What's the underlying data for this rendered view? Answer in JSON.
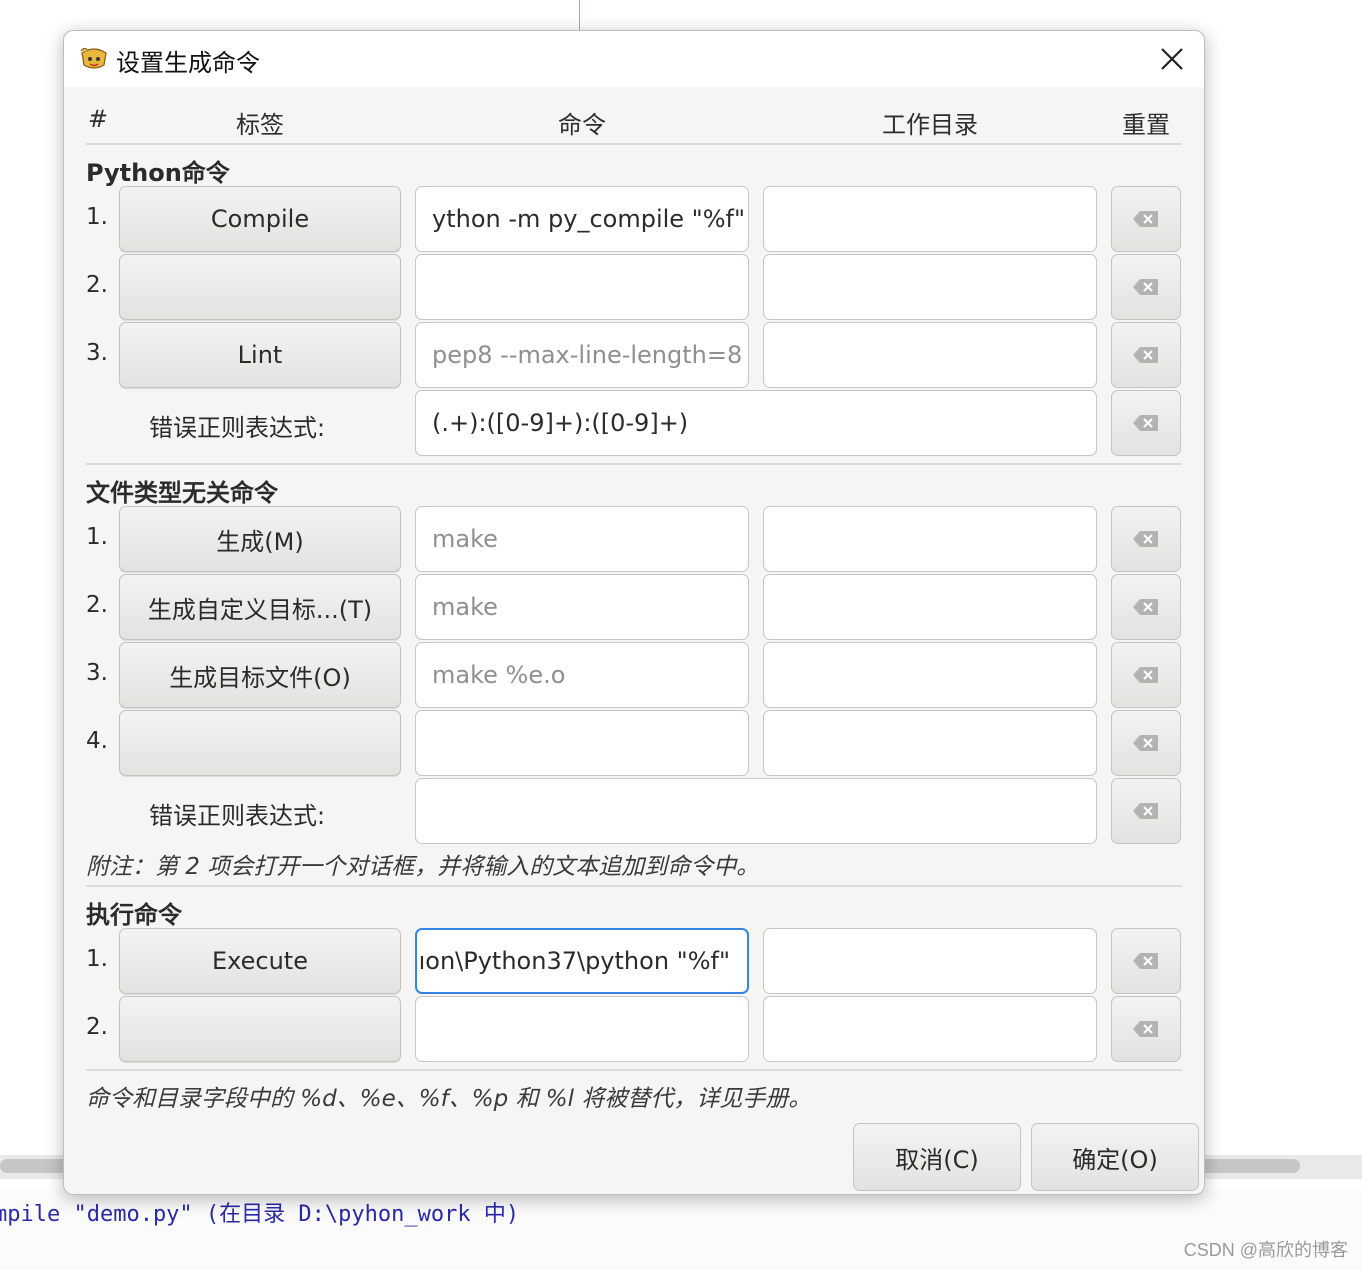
{
  "background": {
    "message": "mpile \"demo.py\" (在目录 D:\\pyhon_work 中)",
    "watermark": "CSDN @高欣的博客"
  },
  "dialog": {
    "title": "设置生成命令",
    "icons": {
      "app": "app-logo-icon",
      "close": "close-icon",
      "reset": "backspace-clear-icon"
    },
    "headers": {
      "num": "#",
      "label": "标签",
      "command": "命令",
      "workdir": "工作目录",
      "reset": "重置"
    },
    "python": {
      "title": "Python命令",
      "rows": [
        {
          "num": "1.",
          "label": "Compile",
          "command": "ython -m py_compile \"%f\"",
          "command_placeholder": "",
          "workdir": ""
        },
        {
          "num": "2.",
          "label": "",
          "command": "",
          "command_placeholder": "",
          "workdir": ""
        },
        {
          "num": "3.",
          "label": "Lint",
          "command": "",
          "command_placeholder": "pep8 --max-line-length=8",
          "workdir": ""
        }
      ],
      "regex_label": "错误正则表达式:",
      "regex_value": "(.+):([0-9]+):([0-9]+)"
    },
    "independent": {
      "title": "文件类型无关命令",
      "rows": [
        {
          "num": "1.",
          "label": "生成(M)",
          "command": "",
          "command_placeholder": "make",
          "workdir": ""
        },
        {
          "num": "2.",
          "label": "生成自定义目标...(T)",
          "command": "",
          "command_placeholder": "make",
          "workdir": ""
        },
        {
          "num": "3.",
          "label": "生成目标文件(O)",
          "command": "",
          "command_placeholder": "make %e.o",
          "workdir": ""
        },
        {
          "num": "4.",
          "label": "",
          "command": "",
          "command_placeholder": "",
          "workdir": ""
        }
      ],
      "regex_label": "错误正则表达式:",
      "regex_value": "",
      "note": "附注：第 2 项会打开一个对话框，并将输入的文本追加到命令中。"
    },
    "execute": {
      "title": "执行命令",
      "rows": [
        {
          "num": "1.",
          "label": "Execute",
          "command": "\\Python37\\python \"%f\"",
          "command_prefix": "ıon",
          "workdir": ""
        },
        {
          "num": "2.",
          "label": "",
          "command": "",
          "workdir": ""
        }
      ]
    },
    "footer_note": "命令和目录字段中的 %d、%e、%f、%p 和 %l 将被替代，详见手册。",
    "buttons": {
      "cancel": "取消(C)",
      "ok": "确定(O)"
    }
  }
}
